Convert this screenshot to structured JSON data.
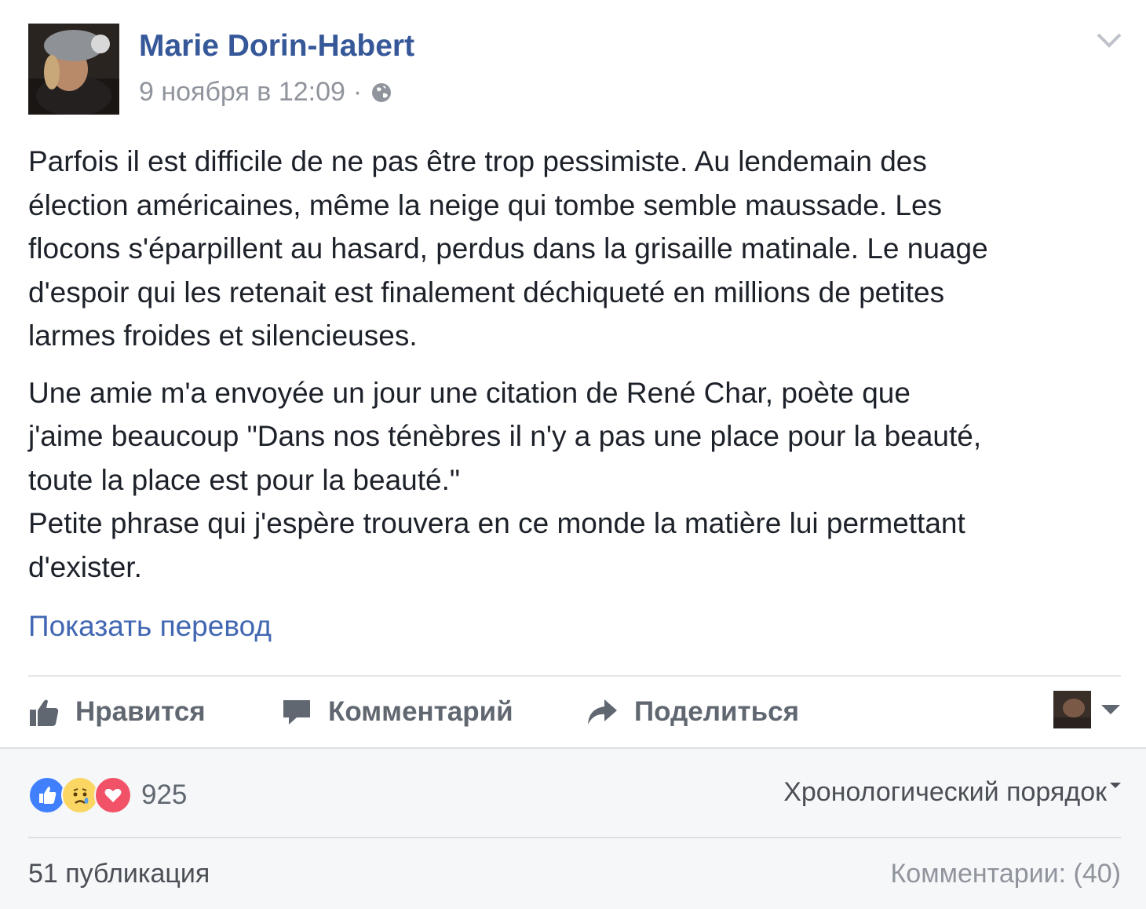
{
  "post": {
    "author": "Marie Dorin-Habert",
    "timestamp": "9 ноября в 12:09",
    "separator": "·",
    "privacy_icon": "globe-icon",
    "paragraphs": [
      [
        "Parfois il est difficile de ne pas être trop pessimiste. Au lendemain des",
        "élection américaines, même la neige qui tombe semble maussade. Les",
        "flocons s'éparpillent au hasard, perdus dans la grisaille matinale. Le nuage",
        "d'espoir qui les retenait est finalement déchiqueté en millions de petites",
        "larmes froides et silencieuses."
      ],
      [
        "Une amie m'a envoyée un jour une citation de René Char, poète que",
        "j'aime beaucoup \"Dans nos ténèbres il n'y a pas une place pour la beauté,",
        "toute la place est pour la beauté.\"",
        "Petite phrase qui j'espère trouvera en ce monde la matière lui permettant",
        "d'exister."
      ]
    ],
    "translate_link": "Показать перевод"
  },
  "actions": {
    "like": "Нравится",
    "comment": "Комментарий",
    "share": "Поделиться"
  },
  "footer": {
    "reaction_icons": [
      "like-reaction-icon",
      "sad-reaction-icon",
      "love-reaction-icon"
    ],
    "reaction_count": "925",
    "sort_order": "Хронологический порядок",
    "shares": "51 публикация",
    "comments": "Комментарии: (40)"
  },
  "colors": {
    "link": "#365899",
    "like_blue": "#4080ff",
    "love_red": "#f25268",
    "sad_yellow": "#fcd662",
    "footer_bg": "#f6f7f9"
  }
}
